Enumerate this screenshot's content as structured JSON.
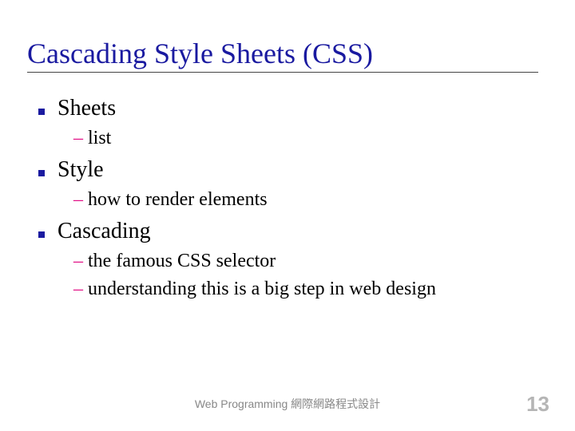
{
  "title": "Cascading Style Sheets (CSS)",
  "items": [
    {
      "label": "Sheets",
      "sub": [
        "list"
      ]
    },
    {
      "label": "Style",
      "sub": [
        "how to render elements"
      ]
    },
    {
      "label": "Cascading",
      "sub": [
        "the famous CSS selector",
        "understanding this is a big step in web design"
      ]
    }
  ],
  "footer": "Web Programming 網際網路程式設計",
  "page_number": "13",
  "colors": {
    "title": "#1a1aa0",
    "dash": "#e21086",
    "pagenum": "#b5b5b5"
  }
}
